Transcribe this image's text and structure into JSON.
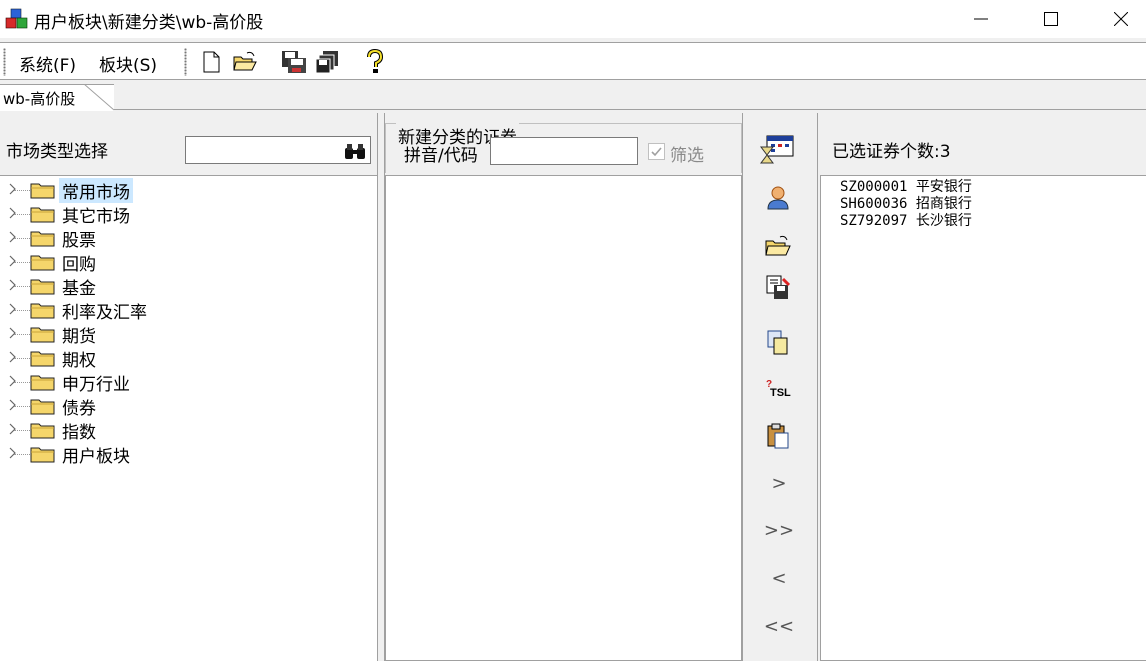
{
  "window": {
    "title": "用户板块\\新建分类\\wb-高价股"
  },
  "menu": {
    "system": "系统(F)",
    "block": "板块(S)"
  },
  "toolbar": {
    "icons": [
      "new-doc-icon",
      "open-folder-icon",
      "save-icon",
      "save-all-icon",
      "help-icon"
    ]
  },
  "tab": {
    "label": "wb-高价股"
  },
  "left": {
    "market_label": "市场类型选择",
    "search_value": "",
    "tree": [
      {
        "label": "常用市场",
        "selected": true
      },
      {
        "label": "其它市场"
      },
      {
        "label": "股票"
      },
      {
        "label": "回购"
      },
      {
        "label": "基金"
      },
      {
        "label": "利率及汇率"
      },
      {
        "label": "期货"
      },
      {
        "label": "期权"
      },
      {
        "label": "申万行业"
      },
      {
        "label": "债券"
      },
      {
        "label": "指数"
      },
      {
        "label": "用户板块"
      }
    ]
  },
  "middle": {
    "group_title": "新建分类的证券",
    "pinyin_label": "拼音/代码",
    "pinyin_value": "",
    "filter_label": "筛选",
    "filter_checked": true
  },
  "actions": {
    "arrows": {
      "add": ">",
      "add_all": ">>",
      "remove": "<",
      "remove_all": "<<"
    }
  },
  "right": {
    "count_label": "已选证券个数:3",
    "items": [
      "SZ000001 平安银行",
      "SH600036 招商银行",
      "SZ792097 长沙银行"
    ]
  },
  "colors": {
    "selection": "#cce8ff",
    "folder": "#f5d66b",
    "accent": "#0078d7"
  }
}
